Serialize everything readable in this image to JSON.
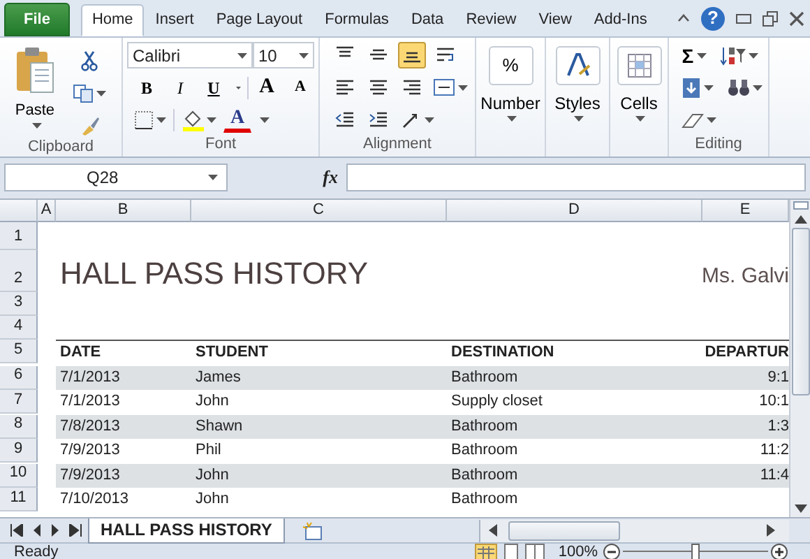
{
  "tabs": [
    {
      "label": "File",
      "kind": "file",
      "selected": false
    },
    {
      "label": "Home",
      "kind": "tab",
      "selected": true
    },
    {
      "label": "Insert",
      "kind": "tab",
      "selected": false
    },
    {
      "label": "Page Layout",
      "kind": "tab",
      "selected": false
    },
    {
      "label": "Formulas",
      "kind": "tab",
      "selected": false
    },
    {
      "label": "Data",
      "kind": "tab",
      "selected": false
    },
    {
      "label": "Review",
      "kind": "tab",
      "selected": false
    },
    {
      "label": "View",
      "kind": "tab",
      "selected": false
    },
    {
      "label": "Add-Ins",
      "kind": "tab",
      "selected": false
    }
  ],
  "help": "?",
  "ribbon": {
    "clipboard": {
      "paste": "Paste",
      "label": "Clipboard"
    },
    "font": {
      "name": "Calibri",
      "size": "10",
      "bold": "B",
      "italic": "I",
      "underline": "U",
      "grow": "A",
      "shrink": "A",
      "color_letter": "A",
      "label": "Font"
    },
    "alignment": {
      "label": "Alignment",
      "buttons": [
        {
          "kind": "top",
          "selected": false
        },
        {
          "kind": "middle",
          "selected": false
        },
        {
          "kind": "bottom",
          "selected": true
        },
        {
          "kind": "wrap",
          "selected": false
        },
        {
          "kind": "left",
          "selected": false
        },
        {
          "kind": "center",
          "selected": false
        },
        {
          "kind": "right",
          "selected": false
        },
        {
          "kind": "merge",
          "selected": false
        },
        {
          "kind": "outdent",
          "selected": false
        },
        {
          "kind": "indent",
          "selected": false
        },
        {
          "kind": "orientation",
          "selected": false
        }
      ]
    },
    "number": {
      "symbol": "%",
      "label": "Number"
    },
    "styles": {
      "label": "Styles"
    },
    "cells": {
      "label": "Cells"
    },
    "editing": {
      "sum": "Σ",
      "label": "Editing"
    }
  },
  "formula_bar": {
    "name_box": "Q28",
    "fx": "fx"
  },
  "columns": [
    "A",
    "B",
    "C",
    "D",
    "E"
  ],
  "row_numbers": [
    "1",
    "2",
    "3",
    "4",
    "5",
    "6",
    "7",
    "8",
    "9",
    "10",
    "11"
  ],
  "sheet": {
    "title": "HALL PASS HISTORY",
    "teacher": "Ms. Galvi",
    "header": [
      "DATE",
      "STUDENT",
      "DESTINATION",
      "DEPARTUR"
    ],
    "rows": [
      [
        "7/1/2013",
        "James",
        "Bathroom",
        "9:1"
      ],
      [
        "7/1/2013",
        "John",
        "Supply closet",
        "10:1"
      ],
      [
        "7/8/2013",
        "Shawn",
        "Bathroom",
        "1:3"
      ],
      [
        "7/9/2013",
        "Phil",
        "Bathroom",
        "11:2"
      ],
      [
        "7/9/2013",
        "John",
        "Bathroom",
        "11:4"
      ],
      [
        "7/10/2013",
        "John",
        "Bathroom",
        ""
      ]
    ]
  },
  "sheet_tabs": [
    {
      "label": "HALL PASS HISTORY",
      "selected": true
    }
  ],
  "status_bar": {
    "text": "Ready",
    "zoom": "100%",
    "zoom_slider": {
      "level": 0.5
    }
  }
}
